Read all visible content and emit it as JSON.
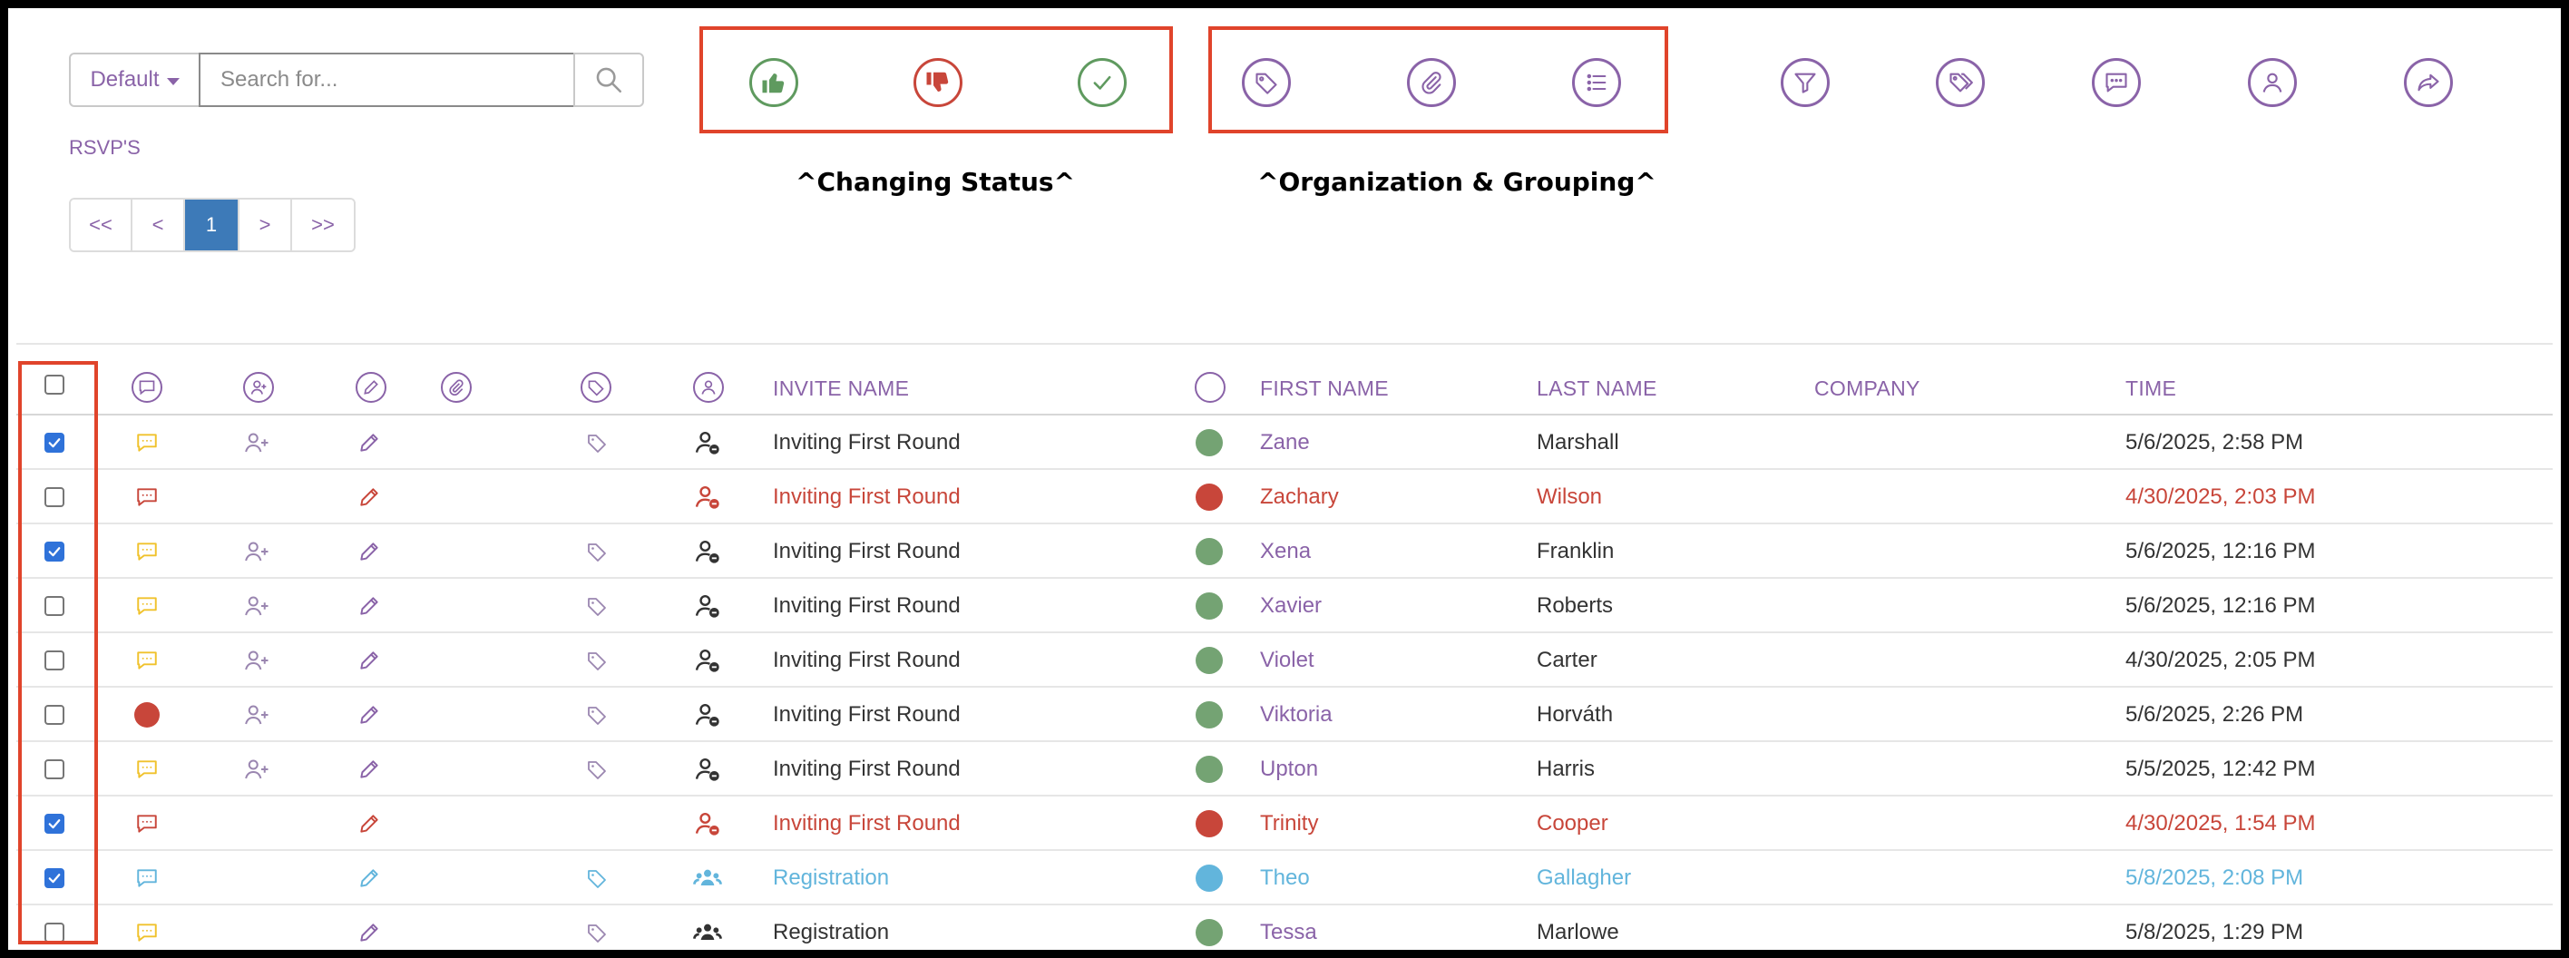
{
  "colors": {
    "accent": "#8a63a8",
    "active_page": "#3d7ab8",
    "red": "#c8463a",
    "green": "#74a373",
    "blue": "#62b5dc",
    "yellow": "#f0c22c",
    "highlight": "#e0442b"
  },
  "toolbar": {
    "default_select": "Default",
    "search_placeholder": "Search for...",
    "rsvps_link": "RSVP'S",
    "pagination": [
      "<<",
      "<",
      "1",
      ">",
      ">>"
    ],
    "active_page": "1",
    "status_caption": "^Changing Status^",
    "org_caption": "^Organization & Grouping^",
    "status_icons": [
      "thumbs-up-icon",
      "thumbs-down-icon",
      "check-icon"
    ],
    "org_icons": [
      "tag-icon",
      "paperclip-icon",
      "list-icon"
    ],
    "extra_icons": [
      "filter-icon",
      "tags-icon",
      "comment-icon",
      "user-icon",
      "share-icon"
    ]
  },
  "table": {
    "headers": {
      "invite_name": "INVITE NAME",
      "first_name": "FIRST NAME",
      "last_name": "LAST NAME",
      "company": "COMPANY",
      "time": "TIME"
    },
    "rows": [
      {
        "checked": true,
        "comment": "yellow",
        "person_add": true,
        "edit": "purple",
        "tag": true,
        "user": "dark",
        "invite": "Inviting First Round",
        "status": "green",
        "first": "Zane",
        "last": "Marshall",
        "company": "",
        "time": "5/6/2025, 2:58 PM",
        "tone": "normal"
      },
      {
        "checked": false,
        "comment": "red",
        "person_add": false,
        "edit": "red",
        "tag": false,
        "user": "red",
        "invite": "Inviting First Round",
        "status": "red",
        "first": "Zachary",
        "last": "Wilson",
        "company": "",
        "time": "4/30/2025, 2:03 PM",
        "tone": "red"
      },
      {
        "checked": true,
        "comment": "yellow",
        "person_add": true,
        "edit": "purple",
        "tag": true,
        "user": "dark",
        "invite": "Inviting First Round",
        "status": "green",
        "first": "Xena",
        "last": "Franklin",
        "company": "",
        "time": "5/6/2025, 12:16 PM",
        "tone": "normal"
      },
      {
        "checked": false,
        "comment": "yellow",
        "person_add": true,
        "edit": "purple",
        "tag": true,
        "user": "dark",
        "invite": "Inviting First Round",
        "status": "green",
        "first": "Xavier",
        "last": "Roberts",
        "company": "",
        "time": "5/6/2025, 12:16 PM",
        "tone": "normal"
      },
      {
        "checked": false,
        "comment": "yellow",
        "person_add": true,
        "edit": "purple",
        "tag": true,
        "user": "dark",
        "invite": "Inviting First Round",
        "status": "green",
        "first": "Violet",
        "last": "Carter",
        "company": "",
        "time": "4/30/2025, 2:05 PM",
        "tone": "normal"
      },
      {
        "checked": false,
        "comment": "red-dot",
        "person_add": true,
        "edit": "purple",
        "tag": true,
        "user": "dark",
        "invite": "Inviting First Round",
        "status": "green",
        "first": "Viktoria",
        "last": "Horváth",
        "company": "",
        "time": "5/6/2025, 2:26 PM",
        "tone": "normal"
      },
      {
        "checked": false,
        "comment": "yellow",
        "person_add": true,
        "edit": "purple",
        "tag": true,
        "user": "dark",
        "invite": "Inviting First Round",
        "status": "green",
        "first": "Upton",
        "last": "Harris",
        "company": "",
        "time": "5/5/2025, 12:42 PM",
        "tone": "normal"
      },
      {
        "checked": true,
        "comment": "red",
        "person_add": false,
        "edit": "red",
        "tag": false,
        "user": "red",
        "invite": "Inviting First Round",
        "status": "red",
        "first": "Trinity",
        "last": "Cooper",
        "company": "",
        "time": "4/30/2025, 1:54 PM",
        "tone": "red"
      },
      {
        "checked": true,
        "comment": "blue",
        "person_add": false,
        "edit": "blue",
        "tag": true,
        "user": "blue-group",
        "invite": "Registration",
        "status": "blue",
        "first": "Theo",
        "last": "Gallagher",
        "company": "",
        "time": "5/8/2025, 2:08 PM",
        "tone": "blue"
      },
      {
        "checked": false,
        "comment": "yellow",
        "person_add": false,
        "edit": "purple",
        "tag": true,
        "user": "dark-group",
        "invite": "Registration",
        "status": "green",
        "first": "Tessa",
        "last": "Marlowe",
        "company": "",
        "time": "5/8/2025, 1:29 PM",
        "tone": "normal"
      }
    ]
  }
}
